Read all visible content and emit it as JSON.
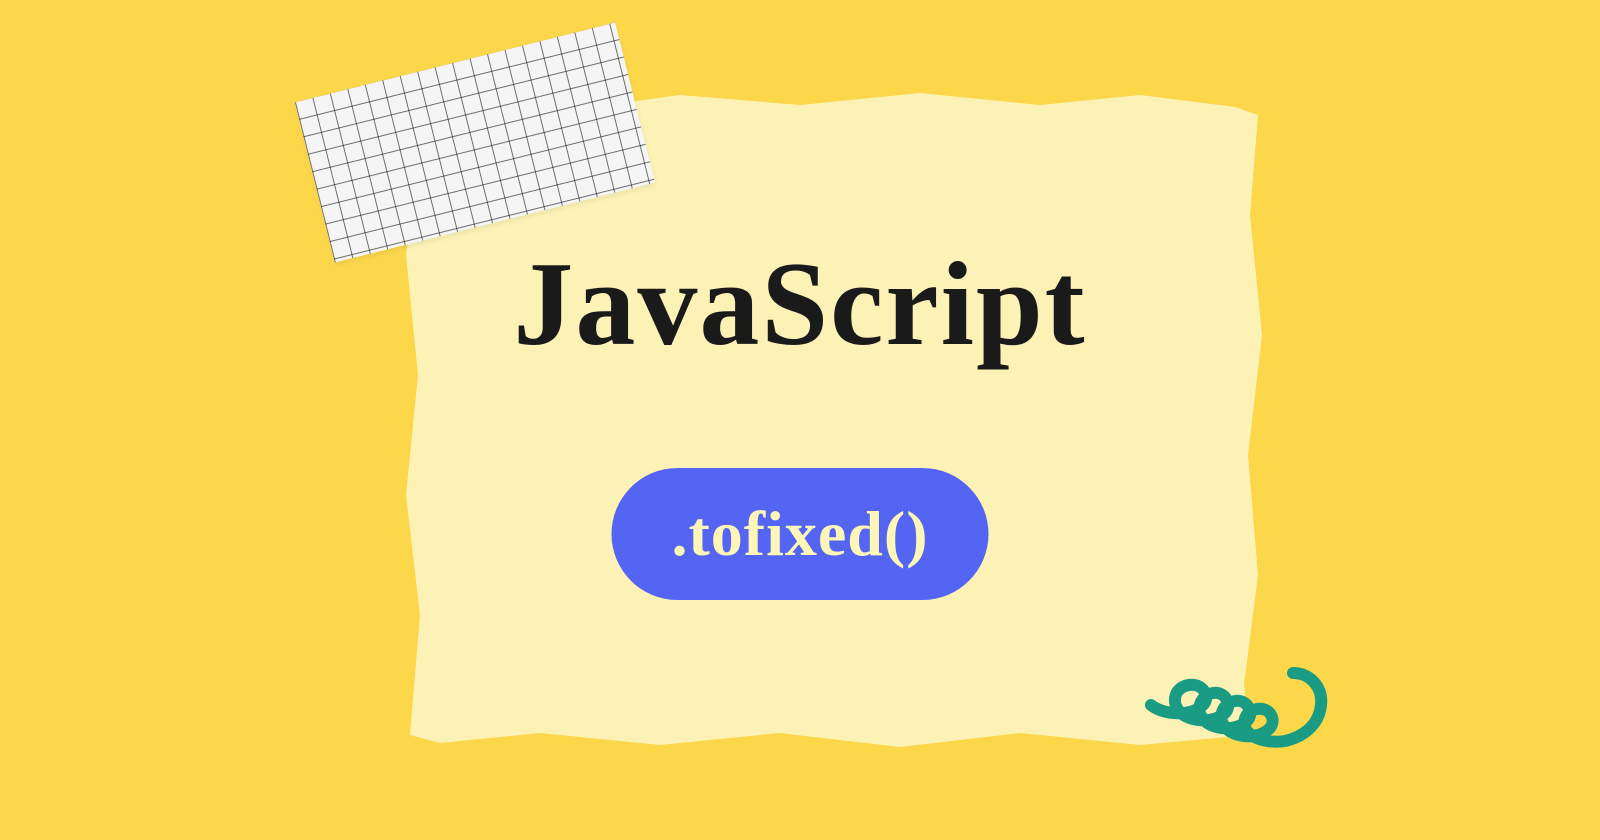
{
  "title": "JavaScript",
  "pill_label": ".tofixed()",
  "colors": {
    "background": "#FCD74A",
    "note": "#FCF2B6",
    "pill": "#5365F2",
    "pill_text": "#FEF6B6",
    "squiggle": "#1A9C84",
    "text": "#1a1a1a"
  }
}
